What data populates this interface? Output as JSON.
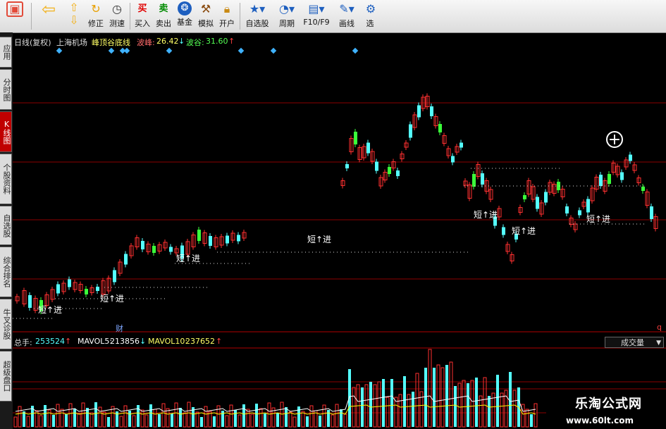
{
  "toolbar": {
    "items": [
      {
        "label": "",
        "icon": "layout-icon"
      },
      {
        "label": "",
        "icon": "back-arrow-icon"
      },
      {
        "label": "",
        "icon": "up-down-arrow-icon"
      },
      {
        "label": "修正",
        "icon": "refresh-icon"
      },
      {
        "label": "测速",
        "icon": "clock-icon"
      },
      {
        "label": "买入",
        "icon": "buy-icon",
        "glyph": "买"
      },
      {
        "label": "卖出",
        "icon": "sell-icon",
        "glyph": "卖"
      },
      {
        "label": "基金",
        "icon": "fund-icon"
      },
      {
        "label": "模拟",
        "icon": "hammer-icon"
      },
      {
        "label": "开户",
        "icon": "lock-icon"
      },
      {
        "label": "自选股",
        "icon": "star-icon"
      },
      {
        "label": "周期",
        "icon": "period-icon"
      },
      {
        "label": "F10/F9",
        "icon": "f10-icon"
      },
      {
        "label": "画线",
        "icon": "pen-icon"
      },
      {
        "label": "选",
        "icon": "select-icon"
      }
    ]
  },
  "left_tabs": [
    {
      "label": "应用",
      "active": false
    },
    {
      "label": "分时图",
      "active": false
    },
    {
      "label": "K线图",
      "active": true
    },
    {
      "label": "个股资料",
      "active": false
    },
    {
      "label": "自选股",
      "active": false
    },
    {
      "label": "综合排名",
      "active": false
    },
    {
      "label": "牛叉诊股",
      "active": false
    },
    {
      "label": "超级盘口",
      "active": false
    }
  ],
  "header": {
    "period": "日线(复权)",
    "stock": "上海机场",
    "indicator": "峰顶谷底线",
    "peak_label": "波峰:",
    "peak_value": "26.42",
    "peak_arrow": "↓",
    "trough_label": "波谷:",
    "trough_value": "31.60",
    "trough_arrow": "↑"
  },
  "volume_panel": {
    "total_label": "总手:",
    "total_value": "253524",
    "total_arrow": "↑",
    "mavol5_label": "MAVOL5:",
    "mavol5_value": "213856",
    "mavol5_arrow": "↓",
    "mavol10_label": "MAVOL10:",
    "mavol10_value": "237652",
    "mavol10_arrow": "↑",
    "dropdown_value": "成交量"
  },
  "signals": [
    "短↑进",
    "短↑进",
    "短↑进",
    "短↑进",
    "短↑进",
    "短↑进",
    "短↑进",
    "短↑进"
  ],
  "markers": {
    "finance": "财",
    "q": "q"
  },
  "watermark": {
    "line1": "乐淘公式网",
    "line2": "www.60lt.com"
  },
  "colors": {
    "up": "#ff3030",
    "down": "#54ffff",
    "down_green": "#3aff3a",
    "grid": "#8b0000",
    "mavol5": "#ffffff",
    "mavol10": "#ffff00",
    "diamond": "#3fb2ff"
  }
}
